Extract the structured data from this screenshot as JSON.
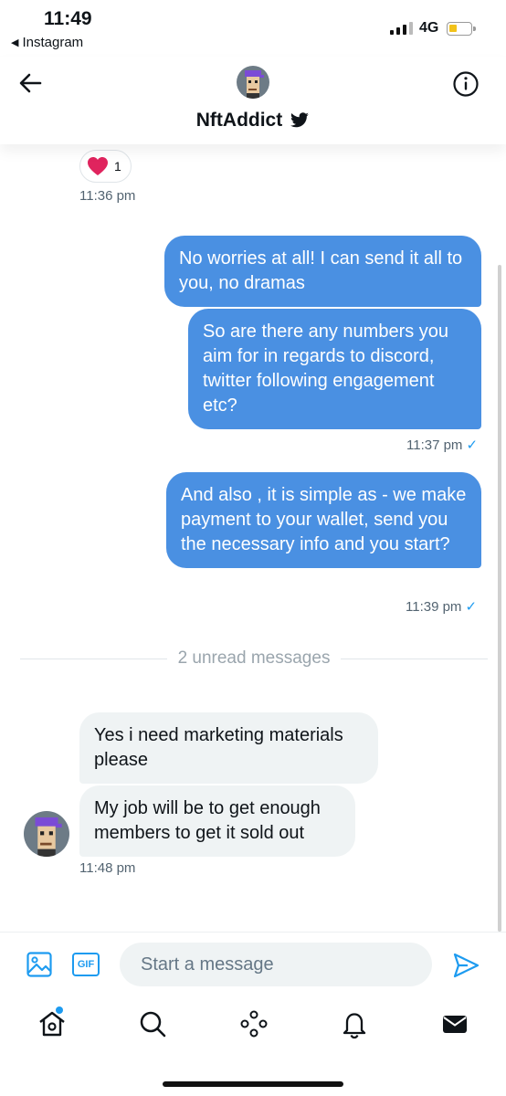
{
  "status": {
    "time": "11:49",
    "back_app": "Instagram",
    "network": "4G"
  },
  "header": {
    "name": "NftAddict"
  },
  "messages": {
    "reaction_count": "1",
    "ts1": "11:36 pm",
    "out1": "No worries at all! I can send it all to you, no dramas",
    "out2": "So are there any numbers you aim for in regards to discord, twitter following engagement etc?",
    "ts2": "11:37 pm",
    "out3": "And also , it is simple as - we make payment to your wallet, send you the necessary info and you start?",
    "ts3": "11:39 pm",
    "unread": "2 unread messages",
    "in1": "Yes i need marketing materials please",
    "in2": "My job will be to get enough members to get it sold out",
    "ts4": "11:48 pm"
  },
  "composer": {
    "placeholder": "Start a message",
    "gif_label": "GIF"
  },
  "colors": {
    "accent": "#1d9bf0",
    "outgoing_bubble": "#4a90e2",
    "incoming_bubble": "#eff3f4"
  }
}
